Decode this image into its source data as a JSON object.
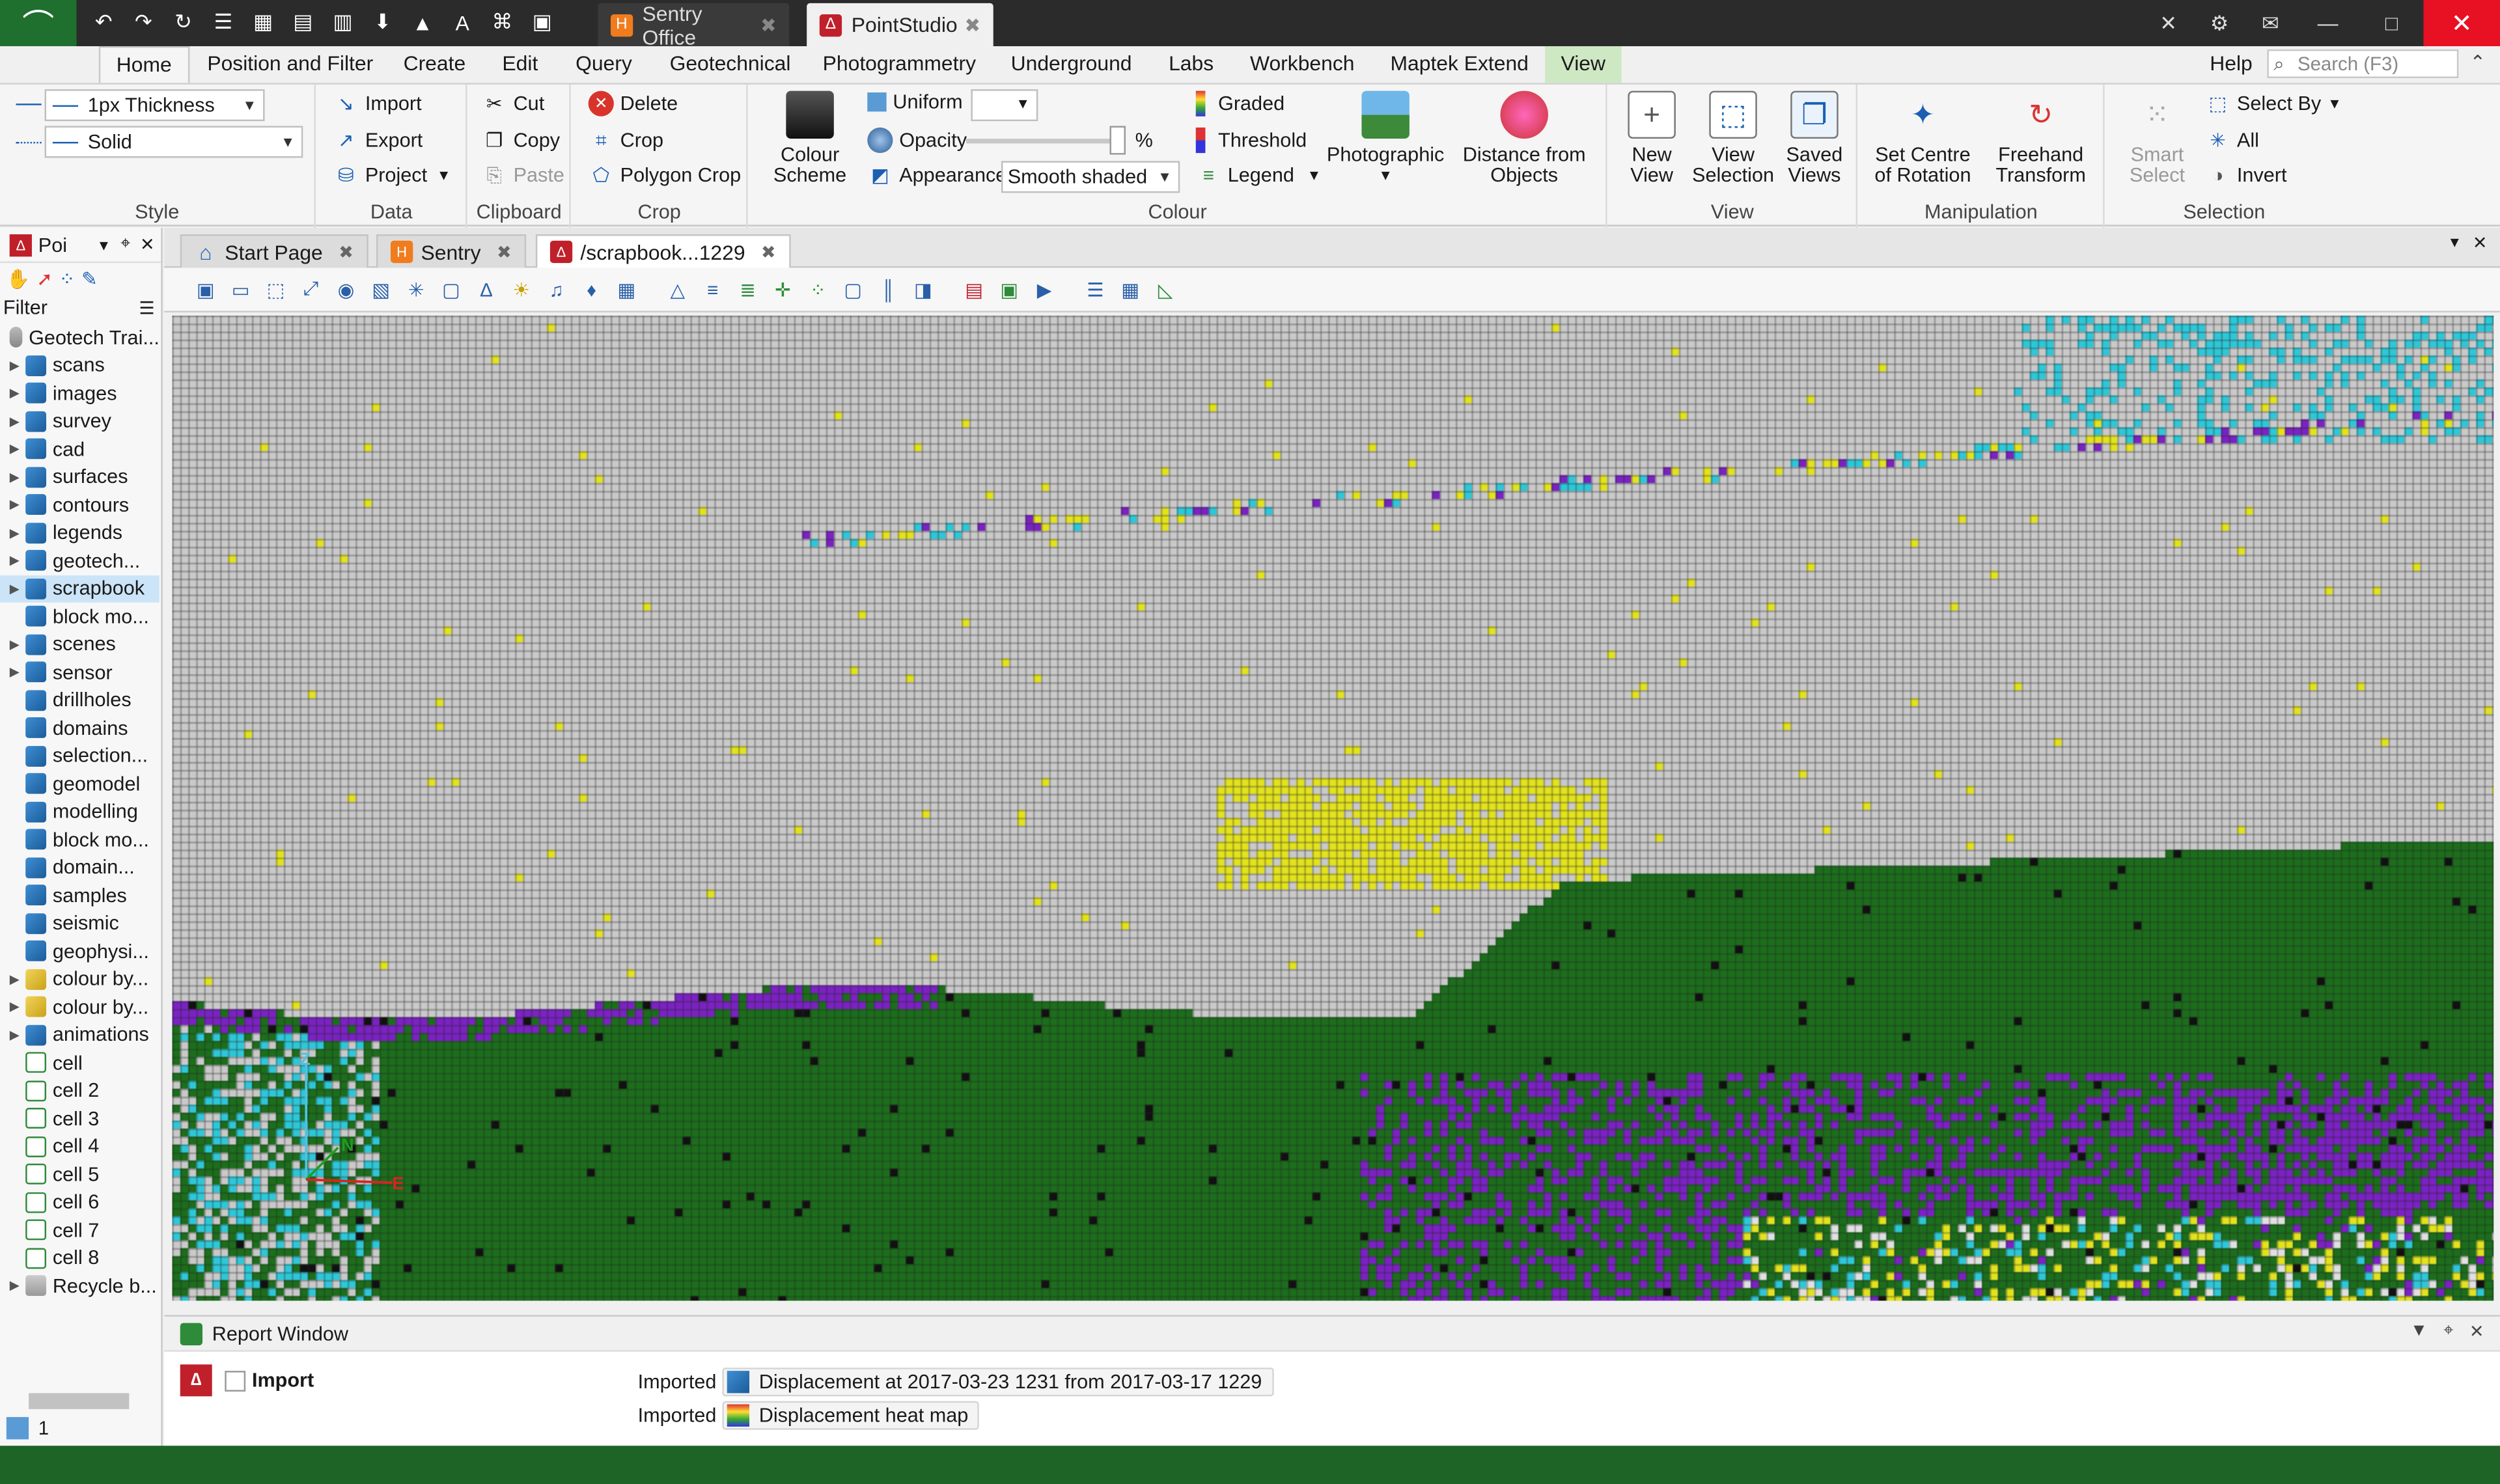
{
  "window": {
    "tabs": [
      {
        "label": "Sentry Office",
        "icon": "sentry-icon",
        "color": "#f07c1e"
      },
      {
        "label": "PointStudio",
        "icon": "pointstudio-icon",
        "color": "#c0202a"
      }
    ]
  },
  "ribbon_tabs": [
    "Home",
    "Position and Filter",
    "Create",
    "Edit",
    "Query",
    "Geotechnical",
    "Photogrammetry",
    "Underground",
    "Labs",
    "Workbench",
    "Maptek Extend",
    "View"
  ],
  "help_label": "Help",
  "search_placeholder": "Search (F3)",
  "style_group": {
    "thickness": "1px Thickness",
    "line_style": "Solid",
    "label": "Style"
  },
  "data_group": {
    "import": "Import",
    "export": "Export",
    "project": "Project",
    "label": "Data"
  },
  "clipboard_group": {
    "cut": "Cut",
    "copy": "Copy",
    "paste": "Paste",
    "label": "Clipboard"
  },
  "crop_group": {
    "delete": "Delete",
    "crop": "Crop",
    "polygon_crop": "Polygon Crop",
    "label": "Crop"
  },
  "colour_group": {
    "colour_scheme": "Colour Scheme",
    "uniform": "Uniform",
    "opacity": "Opacity",
    "opacity_unit": "%",
    "appearance": "Appearance",
    "appearance_value": "Smooth shaded",
    "graded": "Graded",
    "threshold": "Threshold",
    "legend": "Legend",
    "photographic": "Photographic",
    "distance_from_objects": "Distance from Objects",
    "label": "Colour"
  },
  "view_group": {
    "new_view": "New View",
    "view_selection": "View Selection",
    "saved_views": "Saved Views",
    "label": "View"
  },
  "manipulation_group": {
    "set_centre": "Set Centre of Rotation",
    "freehand": "Freehand Transform",
    "label": "Manipulation"
  },
  "selection_group": {
    "smart_select": "Smart Select",
    "select_by": "Select By",
    "all": "All",
    "invert": "Invert",
    "label": "Selection"
  },
  "project_panel": {
    "title": "Poi",
    "filter_label": "Filter",
    "root": "Geotech Trai...",
    "items": [
      {
        "label": "scans",
        "icon": "blue",
        "expandable": true
      },
      {
        "label": "images",
        "icon": "blue",
        "expandable": true
      },
      {
        "label": "survey",
        "icon": "blue",
        "expandable": true
      },
      {
        "label": "cad",
        "icon": "blue",
        "expandable": true
      },
      {
        "label": "surfaces",
        "icon": "blue",
        "expandable": true
      },
      {
        "label": "contours",
        "icon": "blue",
        "expandable": true
      },
      {
        "label": "legends",
        "icon": "blue",
        "expandable": true
      },
      {
        "label": "geotech...",
        "icon": "blue",
        "expandable": true
      },
      {
        "label": "scrapbook",
        "icon": "blue",
        "expandable": true,
        "selected": true
      },
      {
        "label": "block mo...",
        "icon": "blue",
        "expandable": false
      },
      {
        "label": "scenes",
        "icon": "blue",
        "expandable": true
      },
      {
        "label": "sensor",
        "icon": "blue",
        "expandable": true
      },
      {
        "label": "drillholes",
        "icon": "blue",
        "expandable": false
      },
      {
        "label": "domains",
        "icon": "blue",
        "expandable": false
      },
      {
        "label": "selection...",
        "icon": "blue",
        "expandable": false
      },
      {
        "label": "geomodel",
        "icon": "blue",
        "expandable": false
      },
      {
        "label": "modelling",
        "icon": "blue",
        "expandable": false
      },
      {
        "label": "block mo...",
        "icon": "blue",
        "expandable": false
      },
      {
        "label": "domain...",
        "icon": "blue",
        "expandable": false
      },
      {
        "label": "samples",
        "icon": "blue",
        "expandable": false
      },
      {
        "label": "seismic",
        "icon": "blue",
        "expandable": false
      },
      {
        "label": "geophysi...",
        "icon": "blue",
        "expandable": false
      },
      {
        "label": "colour by...",
        "icon": "yellow",
        "expandable": true
      },
      {
        "label": "colour by...",
        "icon": "yellow",
        "expandable": true
      },
      {
        "label": "animations",
        "icon": "blue",
        "expandable": true
      },
      {
        "label": "cell",
        "icon": "cell",
        "expandable": false
      },
      {
        "label": "cell 2",
        "icon": "cell",
        "expandable": false
      },
      {
        "label": "cell 3",
        "icon": "cell",
        "expandable": false
      },
      {
        "label": "cell 4",
        "icon": "cell",
        "expandable": false
      },
      {
        "label": "cell 5",
        "icon": "cell",
        "expandable": false
      },
      {
        "label": "cell 6",
        "icon": "cell",
        "expandable": false
      },
      {
        "label": "cell 7",
        "icon": "cell",
        "expandable": false
      },
      {
        "label": "cell 8",
        "icon": "cell",
        "expandable": false
      },
      {
        "label": "Recycle b...",
        "icon": "bin",
        "expandable": true
      }
    ],
    "status_count": "1"
  },
  "document_tabs": [
    {
      "label": "Start Page",
      "icon": "home-icon"
    },
    {
      "label": "Sentry",
      "icon": "sentry-icon"
    },
    {
      "label": "/scrapbook...1229",
      "icon": "pointstudio-icon",
      "active": true
    }
  ],
  "viewport": {
    "axis_labels": {
      "z": "Z",
      "n": "N",
      "e": "E"
    },
    "colors": {
      "grey": "#c9c9c9",
      "green": "#1c6e1c",
      "purple": "#7b22c2",
      "yellow": "#e2e21e",
      "cyan": "#2ec7d8",
      "blue": "#1e46d2",
      "black": "#111111"
    }
  },
  "report": {
    "title": "Report Window",
    "entry_label": "Import",
    "lines": [
      {
        "prefix": "Imported",
        "text": "Displacement at 2017-03-23 1231 from 2017-03-17 1229",
        "icon": "displacement-icon"
      },
      {
        "prefix": "Imported",
        "text": "Displacement heat map",
        "icon": "heatmap-icon"
      }
    ]
  }
}
